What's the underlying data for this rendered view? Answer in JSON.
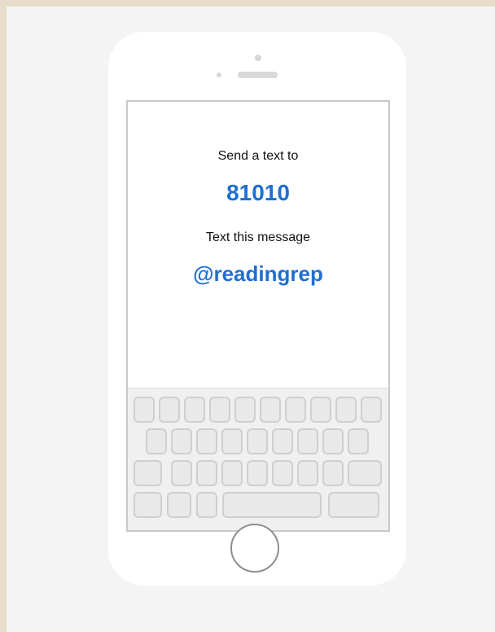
{
  "message": {
    "prompt_line": "Send a text to",
    "number": "81010",
    "instruction_line": "Text this message",
    "code": "@readingrep"
  },
  "colors": {
    "accent": "#1f6fd1",
    "page_background": "#e6ddcb",
    "panel_background": "#f4f4f4",
    "phone_body": "#ffffff"
  }
}
